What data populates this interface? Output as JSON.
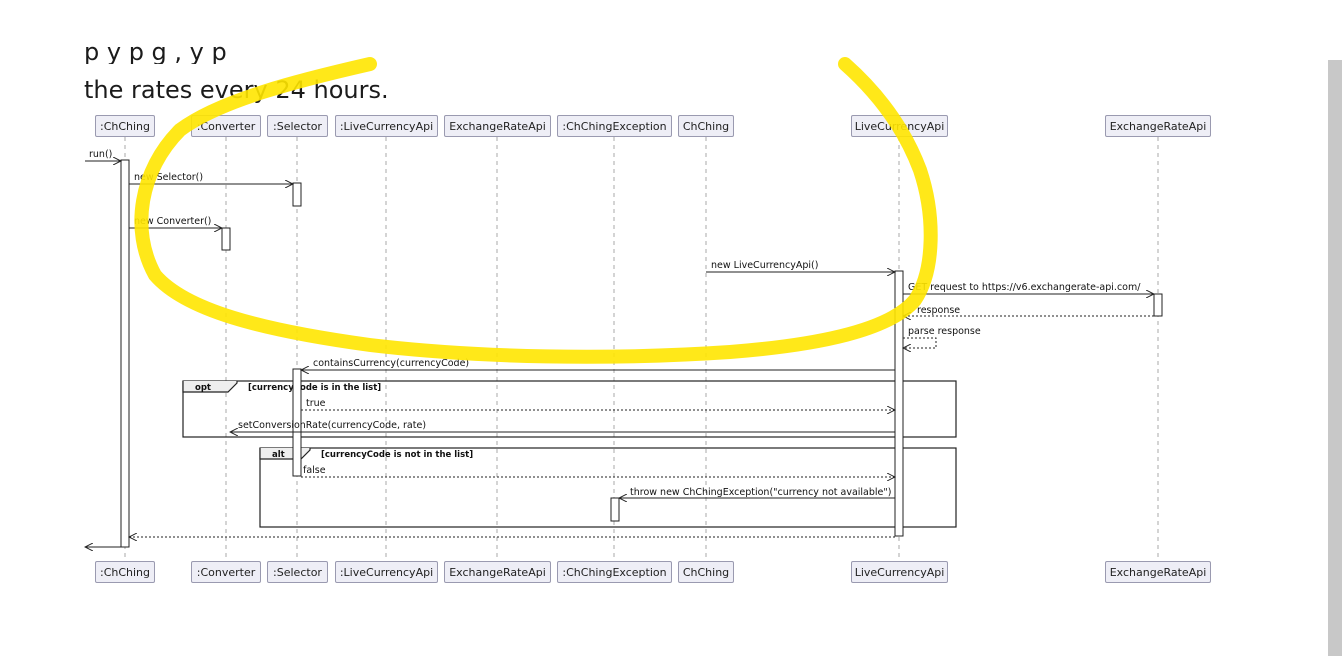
{
  "page": {
    "heading": "the rates every 24 hours.",
    "heading_cut": "                       p          y                                              p   g     ,                                                            y   p"
  },
  "participants": [
    ":ChChing",
    ":Converter",
    ":Selector",
    ":LiveCurrencyApi",
    "ExchangeRateApi",
    ":ChChingException",
    "ChChing",
    "LiveCurrencyApi",
    "ExchangeRateApi"
  ],
  "messages": {
    "run": "run()",
    "new_selector": "new Selector()",
    "new_converter": "new Converter()",
    "new_live_currency_api": "new LiveCurrencyApi()",
    "get_request": "GET request to https://v6.exchangerate-api.com/",
    "response": "response",
    "parse_response": "parse response",
    "contains_currency": "containsCurrency(currencyCode)",
    "true": "true",
    "set_conversion_rate": "setConversionRate(currencyCode, rate)",
    "false": "false",
    "throw_exception": "throw new ChChingException(\"currency not available\")"
  },
  "fragments": {
    "opt_label": "opt",
    "opt_guard": "[currencyCode is in the list]",
    "alt_label": "alt",
    "alt_guard": "[currencyCode is not in the list]"
  },
  "colors": {
    "highlight": "#ffe600",
    "participant_fill": "#eeeef6",
    "participant_border": "#9a9ab0",
    "lifeline": "#a8a8a8"
  }
}
